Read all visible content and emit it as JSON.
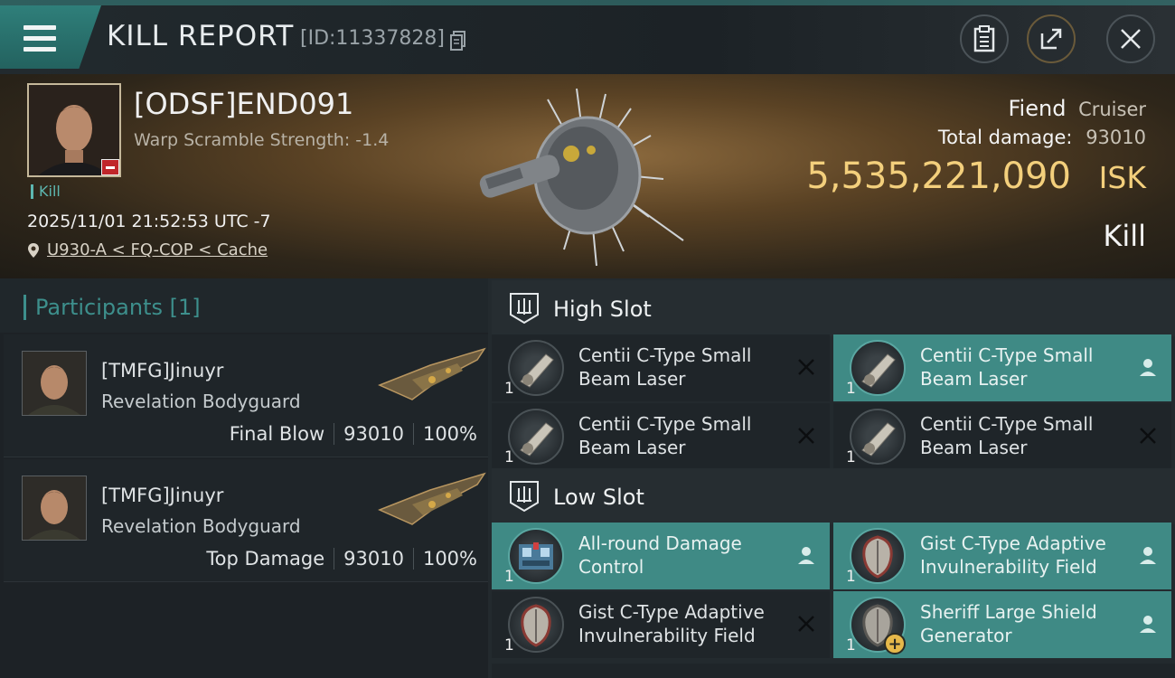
{
  "header": {
    "title": "KILL REPORT",
    "kill_id": "[ID:11337828]"
  },
  "victim": {
    "name": "[ODSF]END091",
    "warp_scramble": "Warp Scramble Strength: -1.4",
    "kill_tag": "Kill",
    "datetime": "2025/11/01 21:52:53 UTC -7",
    "location": "U930-A < FQ-COP < Cache",
    "ship_name": "Fiend",
    "ship_class": "Cruiser",
    "total_damage_label": "Total damage:",
    "total_damage": "93010",
    "isk_value": "5,535,221,090",
    "isk_unit": "ISK",
    "result": "Kill"
  },
  "participants": {
    "title": "Participants [1]",
    "rows": [
      {
        "name": "[TMFG]Jinuyr",
        "ship": "Revelation Bodyguard",
        "role": "Final Blow",
        "damage": "93010",
        "percent": "100%"
      },
      {
        "name": "[TMFG]Jinuyr",
        "ship": "Revelation Bodyguard",
        "role": "Top Damage",
        "damage": "93010",
        "percent": "100%"
      }
    ]
  },
  "fitting": {
    "high_slot": {
      "title": "High Slot",
      "modules": [
        {
          "name": "Centii C-Type Small Beam Laser",
          "qty": "1",
          "action": "x-icon"
        },
        {
          "name": "Centii C-Type Small Beam Laser",
          "qty": "1",
          "action": "person-icon"
        },
        {
          "name": "Centii C-Type Small Beam Laser",
          "qty": "1",
          "action": "x-icon"
        },
        {
          "name": "Centii C-Type Small Beam Laser",
          "qty": "1",
          "action": "x-icon"
        }
      ]
    },
    "low_slot": {
      "title": "Low Slot",
      "modules": [
        {
          "name": "All-round Damage Control",
          "qty": "1",
          "action": "person-icon"
        },
        {
          "name": "Gist C-Type Adaptive Invulnerability Field",
          "qty": "1",
          "action": "person-icon"
        },
        {
          "name": "Gist C-Type Adaptive Invulnerability Field",
          "qty": "1",
          "action": "x-icon"
        },
        {
          "name": "Sheriff Large Shield Generator",
          "qty": "1",
          "action": "person-icon"
        }
      ]
    }
  },
  "colors": {
    "accent_teal": "#3f8a85",
    "isk_gold": "#f3cf7c",
    "penalty_red": "#c0262a"
  }
}
